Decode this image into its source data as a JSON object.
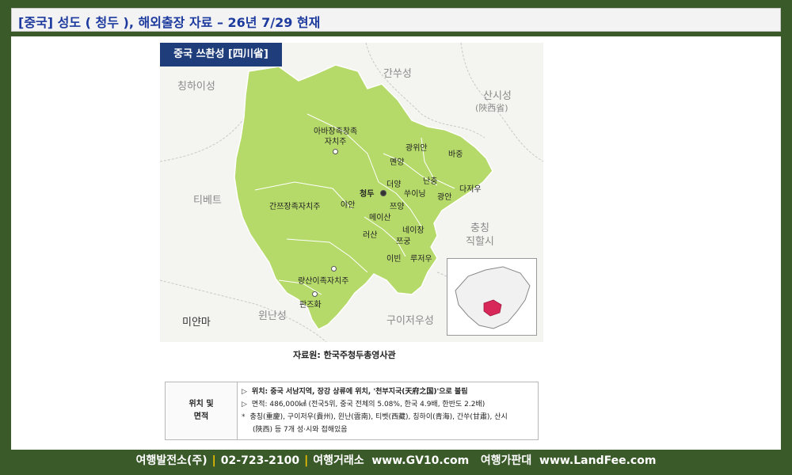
{
  "header": {
    "title": "[중국] 성도 ( 청두 ), 해외출장 자료 – 26년 7/29 현재"
  },
  "map": {
    "title": "중국 쓰촨성 [四川省]",
    "neighbors": {
      "qinghai": "칭하이성",
      "gansu": "간쑤성",
      "shaanxi": "산시성",
      "shaanxi_cn": "(陜西省)",
      "tibet": "티베트",
      "chongqing": "충칭\n직할시",
      "yunnan": "윈난성",
      "guizhou": "구이저우성",
      "myanmar": "미얀마"
    },
    "cities": {
      "aba": "아바장족창족\n자치주",
      "guangyuan": "광위안",
      "bazhong": "바중",
      "mianyang": "몐양",
      "nanchong": "난충",
      "dazhou": "다저우",
      "deyang": "더양",
      "chengdu": "청두",
      "suining": "쑤이닝",
      "guangan": "광안",
      "ganzi": "간쯔장족자치주",
      "yaan": "야안",
      "ziyang": "쯔양",
      "meishan": "메이산",
      "neijiang": "네이장",
      "leshan": "러산",
      "zigong": "쯔궁",
      "yibin": "이빈",
      "luzhou": "루저우",
      "liangshan": "량산이족자치주",
      "panzhihua": "판즈화"
    }
  },
  "source": "자료원: 한국주청두총영사관",
  "info": {
    "head": "위치 및\n면적",
    "row1": "위치: 중국 서남지역, 장강 상류에 위치, '천부지국(天府之国)'으로 불림",
    "row2": "면적: 486,000㎢ (전국5위, 중국 전체의 5.08%, 한국 4.9배, 한반도 2.2배)",
    "row3": "충칭(重慶), 구이저우(貴州), 윈난(雲南), 티벳(西藏), 칭하이(青海), 간쑤(甘肅), 산시",
    "row4": "(陜西) 등 7개 성·시와 접해있음",
    "marker_arrow": "▷",
    "marker_star": "*"
  },
  "footer": {
    "company": "여행발전소(주)",
    "phone": "02-723-2100",
    "site1_label": "여행거래소",
    "site1_url": "www.GV10.com",
    "site2_label": "여행가판대",
    "site2_url": "www.LandFee.com",
    "separator": "|"
  },
  "colors": {
    "background": "#3a5a2a",
    "title_blue": "#1d3a9e",
    "map_title_bg": "#1f3d7a",
    "province_green": "#b5da6a",
    "inset_highlight": "#d8285a",
    "footer_separator": "#f3c300"
  }
}
